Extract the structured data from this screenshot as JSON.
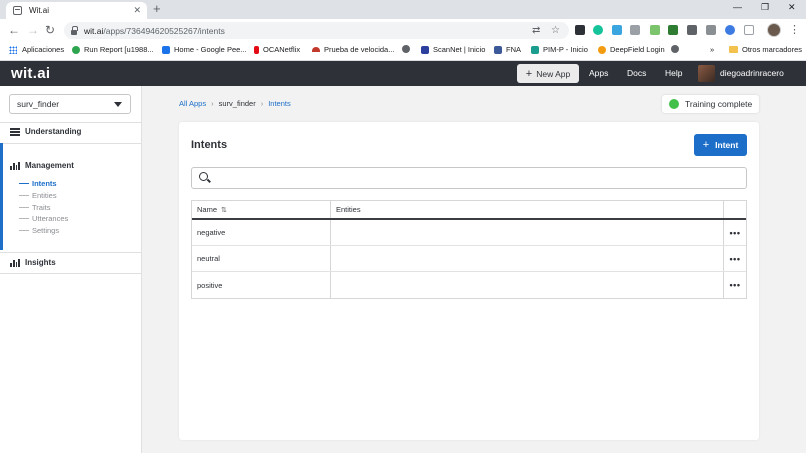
{
  "browser": {
    "tab_title": "Wit.ai",
    "tab_close": "✕",
    "new_tab": "+",
    "window_controls": [
      "—",
      "❐",
      "✕"
    ],
    "url_host": "wit.ai",
    "url_path": "/apps/736494620525267/intents",
    "bookmarks": [
      {
        "label": "Aplicaciones",
        "icon": "apps-grid-icon",
        "color": "#1a73e8"
      },
      {
        "label": "Run Report [u1988...",
        "icon": "run-report-icon",
        "color": "#2ea44f"
      },
      {
        "label": "Home - Google Pee...",
        "icon": "google-peering-icon",
        "color": "#1a73e8"
      },
      {
        "label": "OCANetflix",
        "icon": "netflix-icon",
        "color": "#e50914"
      },
      {
        "label": "Prueba de velocida...",
        "icon": "speedtest-icon",
        "color": "#c0392b"
      },
      {
        "label": "",
        "icon": "globe-icon",
        "color": "#5f6368"
      },
      {
        "label": "ScanNet | Inicio",
        "icon": "scannet-icon",
        "color": "#2c3e9e"
      },
      {
        "label": "FNA",
        "icon": "facebook-icon",
        "color": "#3b5998"
      },
      {
        "label": "PIM-P - Inicio",
        "icon": "pim-icon",
        "color": "#1b9e8f"
      },
      {
        "label": "DeepField Login",
        "icon": "deepfield-icon",
        "color": "#f39c12"
      },
      {
        "label": "",
        "icon": "globe-icon",
        "color": "#5f6368"
      }
    ],
    "bookmarks_overflow": "»",
    "other_bookmarks": "Otros marcadores"
  },
  "header": {
    "logo": "wit.ai",
    "new_app_label": "New App",
    "nav": [
      "Apps",
      "Docs",
      "Help"
    ],
    "user_name": "diegoadrinracero"
  },
  "sidebar": {
    "app_name": "surv_finder",
    "understanding_label": "Understanding",
    "management_label": "Management",
    "management_items": [
      "Intents",
      "Entities",
      "Traits",
      "Utterances",
      "Settings"
    ],
    "insights_label": "Insights"
  },
  "main": {
    "breadcrumb": [
      "All Apps",
      "surv_finder",
      "Intents"
    ],
    "training_status": "Training complete",
    "status_color": "#43c04a",
    "card_title": "Intents",
    "add_intent_label": "Intent",
    "search_placeholder": "",
    "table": {
      "columns": [
        "Name",
        "Entities"
      ],
      "rows": [
        {
          "name": "negative",
          "entities": ""
        },
        {
          "name": "neutral",
          "entities": ""
        },
        {
          "name": "positive",
          "entities": ""
        }
      ]
    }
  },
  "colors": {
    "accent": "#1c6ec8",
    "header_bg": "#2e3238"
  }
}
